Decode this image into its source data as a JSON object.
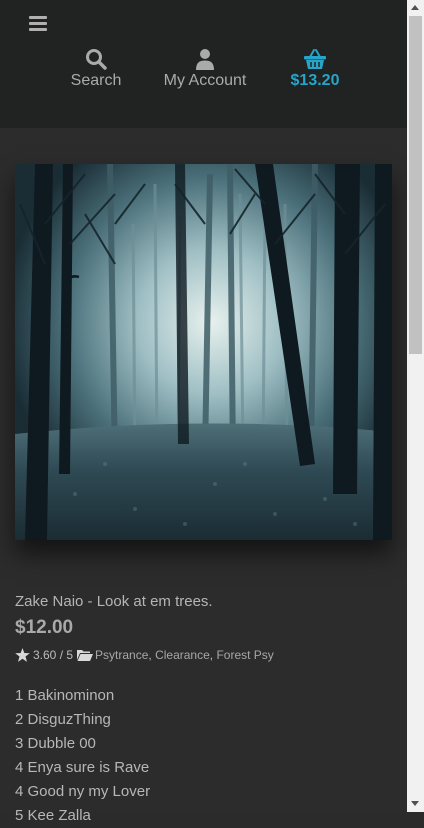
{
  "header": {
    "search_label": "Search",
    "account_label": "My Account",
    "cart_total": "$13.20",
    "cart_color": "#27a5c8"
  },
  "product": {
    "image_alt": "foggy forest",
    "title": "Zake Naio - Look at em trees.",
    "price": "$12.00",
    "rating": "3.60 / 5",
    "categories": [
      "Psytrance",
      "Clearance",
      "Forest Psy"
    ],
    "tracks": [
      "1 Bakinominon",
      "2 DisguzThing",
      "3 Dubble 00",
      "4 Enya sure is Rave",
      "4 Good ny my Lover",
      "5 Kee Zalla"
    ]
  }
}
